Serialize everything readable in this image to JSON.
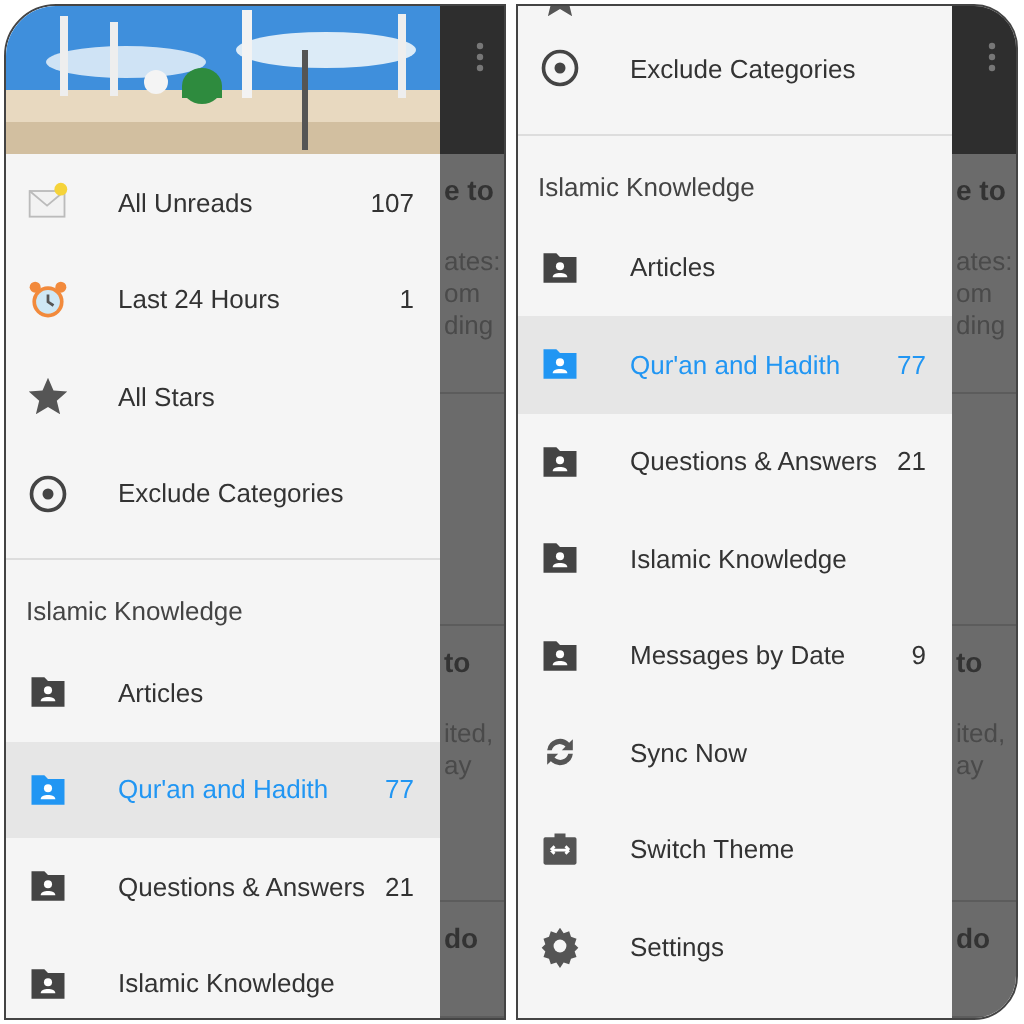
{
  "panels": [
    {
      "items": [
        {
          "kind": "unreads",
          "label": "All Unreads",
          "count": "107",
          "selected": false
        },
        {
          "kind": "recent",
          "label": "Last 24 Hours",
          "count": "1",
          "selected": false
        },
        {
          "kind": "stars",
          "label": "All Stars",
          "selected": false
        },
        {
          "kind": "exclude",
          "label": "Exclude Categories",
          "selected": false
        },
        {
          "kind": "divider"
        },
        {
          "kind": "section",
          "label": "Islamic Knowledge"
        },
        {
          "kind": "folder",
          "label": "Articles",
          "selected": false
        },
        {
          "kind": "folder",
          "label": "Qur'an and Hadith",
          "count": "77",
          "selected": true
        },
        {
          "kind": "folder",
          "label": "Questions & Answers",
          "count": "21",
          "selected": false
        },
        {
          "kind": "folder",
          "label": "Islamic Knowledge",
          "selected": false
        }
      ],
      "behind": {
        "cards": [
          {
            "title": "e to",
            "lines": [
              "ates:",
              "om",
              "ding"
            ]
          },
          {
            "title": "to",
            "lines": [
              "ited,",
              "ay"
            ]
          },
          {
            "title": "do"
          }
        ]
      }
    },
    {
      "items": [
        {
          "kind": "starpeek"
        },
        {
          "kind": "exclude",
          "label": "Exclude Categories",
          "selected": false
        },
        {
          "kind": "divider"
        },
        {
          "kind": "section",
          "label": "Islamic Knowledge"
        },
        {
          "kind": "folder",
          "label": "Articles",
          "selected": false
        },
        {
          "kind": "folder",
          "label": "Qur'an and Hadith",
          "count": "77",
          "selected": true
        },
        {
          "kind": "folder",
          "label": "Questions & Answers",
          "count": "21",
          "selected": false
        },
        {
          "kind": "folder",
          "label": "Islamic Knowledge",
          "selected": false
        },
        {
          "kind": "folder",
          "label": "Messages by Date",
          "count": "9",
          "selected": false
        },
        {
          "kind": "sync",
          "label": "Sync Now",
          "selected": false
        },
        {
          "kind": "theme",
          "label": "Switch Theme",
          "selected": false
        },
        {
          "kind": "settings",
          "label": "Settings",
          "selected": false
        }
      ],
      "behind": {
        "cards": [
          {
            "title": "e to",
            "lines": [
              "ates:",
              "om",
              "ding"
            ]
          },
          {
            "title": "to",
            "lines": [
              "ited,",
              "ay"
            ]
          },
          {
            "title": "do"
          }
        ]
      }
    }
  ]
}
